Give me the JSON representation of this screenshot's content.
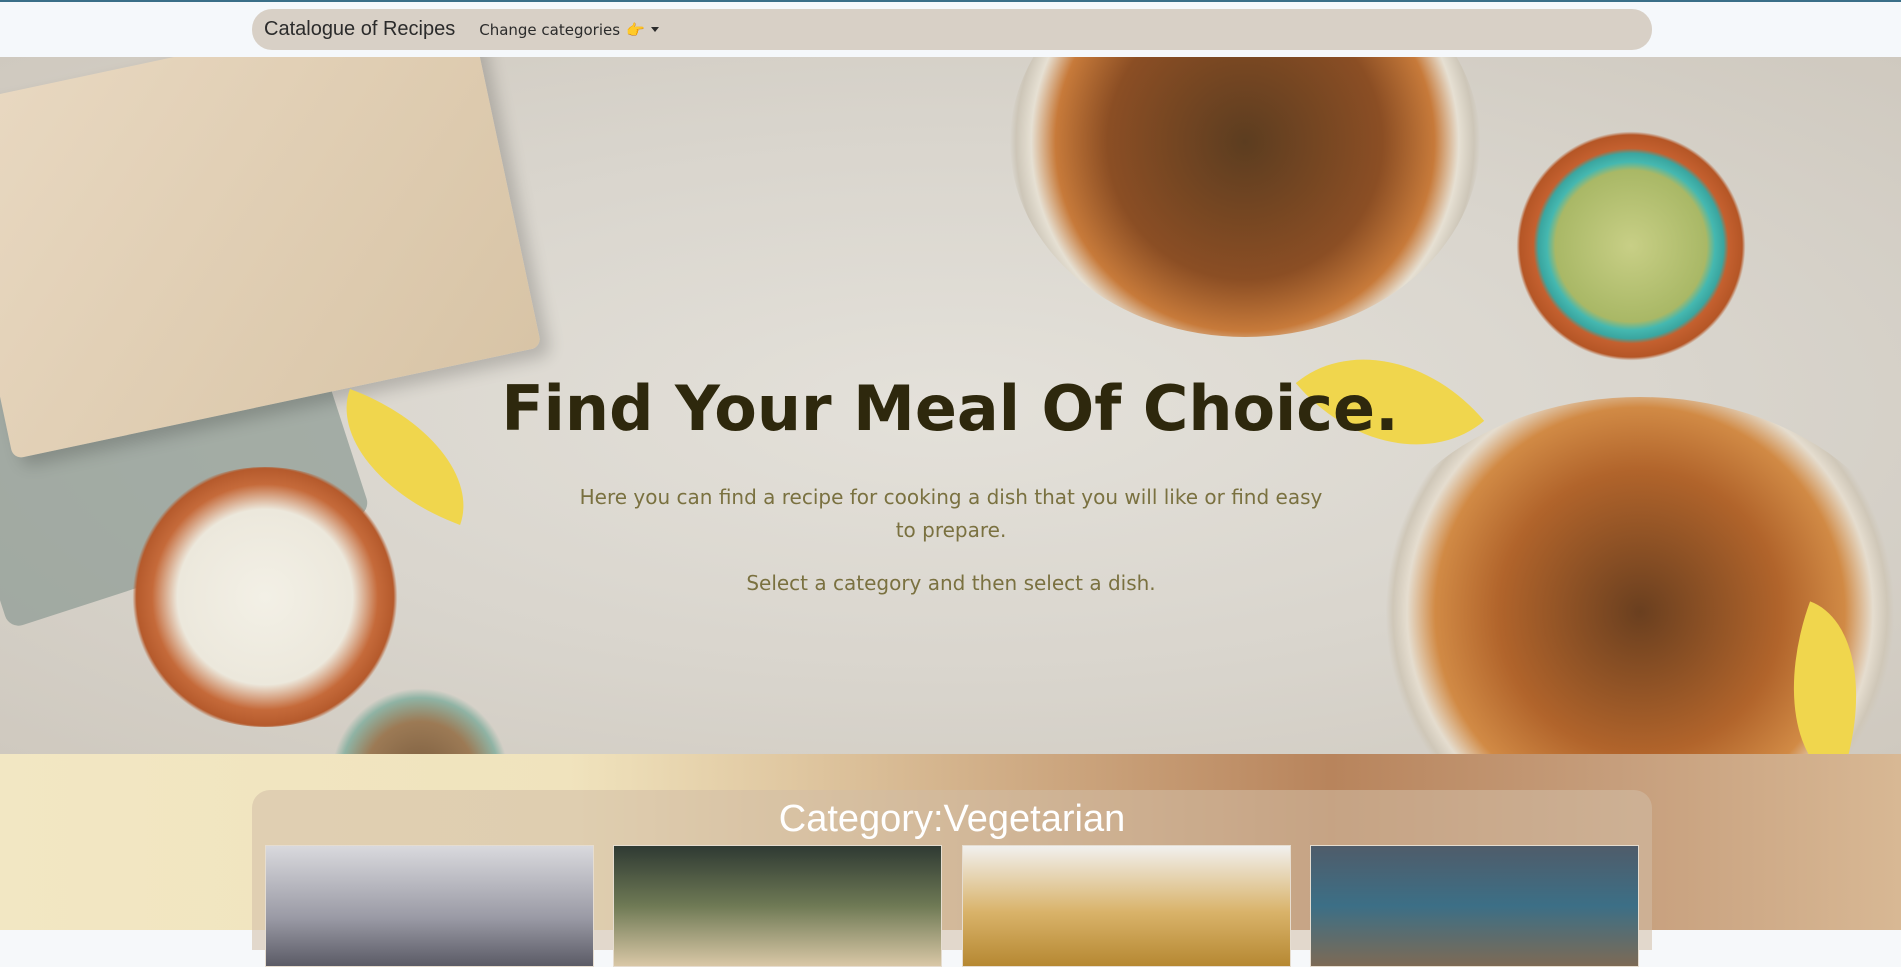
{
  "navbar": {
    "brand": "Catalogue of Recipes",
    "dropdown_label": "Change categories",
    "dropdown_emoji": "👉"
  },
  "hero": {
    "title": "Find Your Meal Of Choice.",
    "text": "Here you can find a recipe for cooking a dish that you will like or find easy to prepare.",
    "subtext": "Select a category and then select a dish."
  },
  "category": {
    "title": "Category:Vegetarian"
  },
  "colors": {
    "navbar_bg": "#d8d0c6",
    "hero_title": "#2e280d",
    "hero_text": "#7a7140"
  }
}
